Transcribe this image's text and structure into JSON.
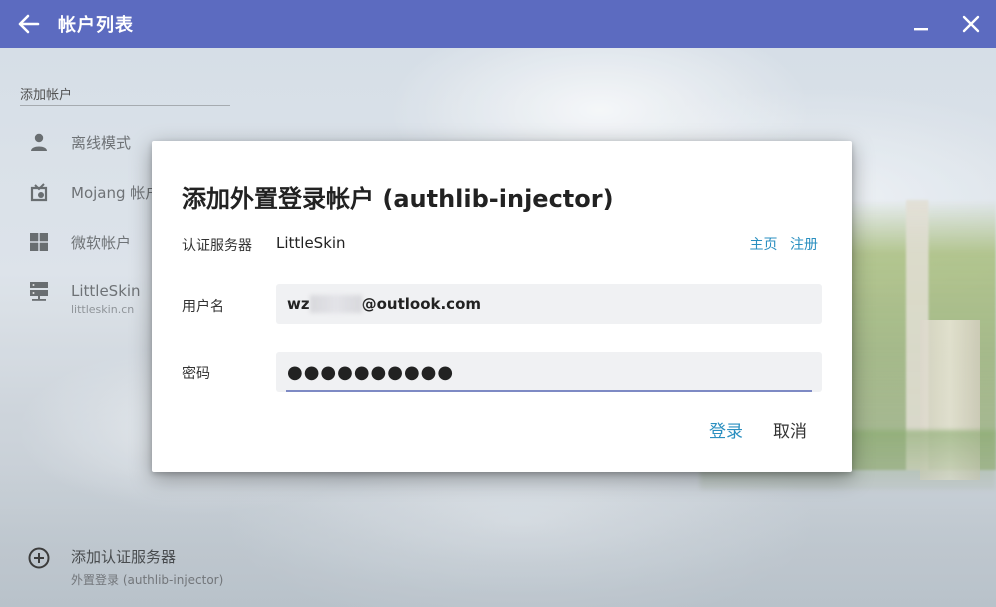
{
  "window": {
    "title": "帐户列表"
  },
  "sidebar": {
    "header": "添加帐户",
    "items": [
      {
        "label": "离线模式",
        "icon": "person-icon"
      },
      {
        "label": "Mojang 帐户",
        "icon": "mojang-icon"
      },
      {
        "label": "微软帐户",
        "icon": "windows-icon"
      },
      {
        "label": "LittleSkin",
        "sub": "littleskin.cn",
        "icon": "server-icon"
      }
    ],
    "add_server": {
      "label": "添加认证服务器",
      "sub": "外置登录 (authlib-injector)"
    }
  },
  "dialog": {
    "title": "添加外置登录帐户 (authlib-injector)",
    "server_label": "认证服务器",
    "server_name": "LittleSkin",
    "link_home": "主页",
    "link_register": "注册",
    "username_label": "用户名",
    "username_prefix": "wz",
    "username_suffix": "@outlook.com",
    "password_label": "密码",
    "password_value": "●●●●●●●●●●",
    "login_label": "登录",
    "cancel_label": "取消"
  },
  "colors": {
    "titlebar": "#5c6bc0",
    "accent_link": "#2a8fc0",
    "field_underline": "#7e8ac4"
  }
}
